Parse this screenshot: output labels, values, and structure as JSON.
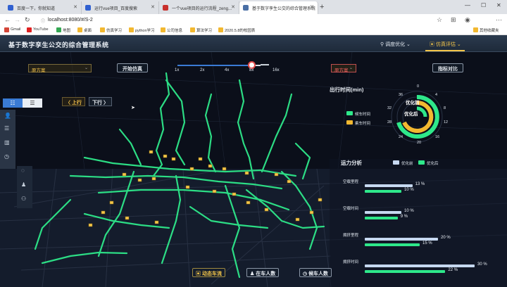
{
  "browser": {
    "tabs": [
      {
        "title": "百度一下，你就知道",
        "color": "#3060d0"
      },
      {
        "title": "运行vue项目_百度搜索",
        "color": "#3060d0"
      },
      {
        "title": "一个vue项目的运行流程_zeng...",
        "color": "#c8302c"
      },
      {
        "title": "基于数字孪生公交的综合管理系统",
        "color": "#4a6fa5"
      }
    ],
    "url": "localhost:8080/#/S-2",
    "bookmarks": [
      {
        "label": "Gmail",
        "color": "#d44638"
      },
      {
        "label": "YouTube",
        "color": "#e02020"
      },
      {
        "label": "地图",
        "color": "#34a853"
      },
      {
        "label": "桌面",
        "color": "#f2b830"
      },
      {
        "label": "仿真学习",
        "color": "#f2b830"
      },
      {
        "label": "python学习",
        "color": "#f2b830"
      },
      {
        "label": "公司信息",
        "color": "#f2b830"
      },
      {
        "label": "算法学习",
        "color": "#f2b830"
      },
      {
        "label": "2020.5.8的校园表",
        "color": "#f2b830"
      }
    ],
    "other_bookmarks": "其他收藏夹"
  },
  "header": {
    "title": "基于数字孪生公交的综合管理系统",
    "nav": [
      {
        "label": "调度优化",
        "active": false
      },
      {
        "label": "仿真评估",
        "active": true
      }
    ]
  },
  "controls": {
    "scheme_left": "原方案",
    "start_sim": "开始仿真",
    "speed_marks": [
      "1x",
      "2x",
      "4x",
      "8x",
      "16x"
    ],
    "speed_value": "8x",
    "scheme_right": "原方案",
    "compare": "指标对比",
    "dir_up": "上行",
    "dir_down": "下行"
  },
  "travel_time": {
    "title": "出行时间(min)",
    "legend": [
      {
        "label": "候车时间",
        "color": "#2ee88a"
      },
      {
        "label": "乘车时间",
        "color": "#f2b830"
      }
    ],
    "radial_labels": [
      "0",
      "4",
      "8",
      "12",
      "16",
      "20",
      "24",
      "28",
      "32",
      "36"
    ],
    "center_labels": [
      "优化前",
      "优化后"
    ]
  },
  "capacity": {
    "title": "运力分析",
    "legend": [
      {
        "label": "优化前",
        "color": "#c6d8f0"
      },
      {
        "label": "优化后",
        "color": "#2ee88a"
      }
    ],
    "rows": [
      {
        "label": "空载里程",
        "before": "13 %",
        "after": "10 %",
        "before_pct": 13,
        "after_pct": 10
      },
      {
        "label": "空载时间",
        "before": "10 %",
        "after": "9 %",
        "before_pct": 10,
        "after_pct": 9
      },
      {
        "label": "拥挤里程",
        "before": "20 %",
        "after": "15 %",
        "before_pct": 20,
        "after_pct": 15
      },
      {
        "label": "拥挤时间",
        "before": "30 %",
        "after": "22 %",
        "before_pct": 30,
        "after_pct": 22
      }
    ]
  },
  "bottom": {
    "flow": "动态车流",
    "onboard": "在车人数",
    "waiting": "候车人数"
  }
}
